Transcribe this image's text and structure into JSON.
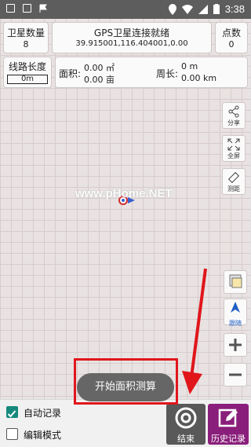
{
  "status_bar": {
    "time": "3:38"
  },
  "top_panel": {
    "satellite_count_label": "卫星数量",
    "satellite_count_value": "8",
    "gps_status": "GPS卫星连接就绪",
    "gps_coords": "39.915001,116.404001,0.00",
    "points_label": "点数",
    "points_value": "0",
    "line_length_label": "线路长度",
    "line_length_value": "0m",
    "area_label": "面积:",
    "area_sqm": "0.00 ㎡",
    "area_mu": "0.00 亩",
    "perimeter_label": "周长:",
    "perimeter_m": "0 m",
    "perimeter_km": "0.00 km"
  },
  "side_tools": {
    "share_label": "分享",
    "fullscreen_label": "全屏",
    "measure_label": "测距",
    "navigate_label": "跟随"
  },
  "map": {
    "watermark": "www.pHome.NET"
  },
  "bottom": {
    "auto_record_label": "自动记录",
    "edit_mode_label": "编辑模式",
    "end_label": "结束",
    "history_label": "历史记录"
  },
  "toast": {
    "text": "开始面积测算"
  },
  "colors": {
    "status_bar": "#5d5d5d",
    "check_accent": "#15897c",
    "end_button": "#595959",
    "history_button": "#8a1f7b",
    "annotation_red": "#e0161b",
    "nav_blue": "#1e5fc4"
  },
  "icons": [
    "picture-icon",
    "flag-icon",
    "location-icon",
    "wifi-icon",
    "signal-icon",
    "battery-icon",
    "share-icon",
    "fullscreen-icon",
    "ruler-icon",
    "layers-icon",
    "navigate-icon",
    "zoom-in-icon",
    "zoom-out-icon",
    "record-icon",
    "edit-icon",
    "checkmark-icon",
    "location-marker-icon"
  ]
}
